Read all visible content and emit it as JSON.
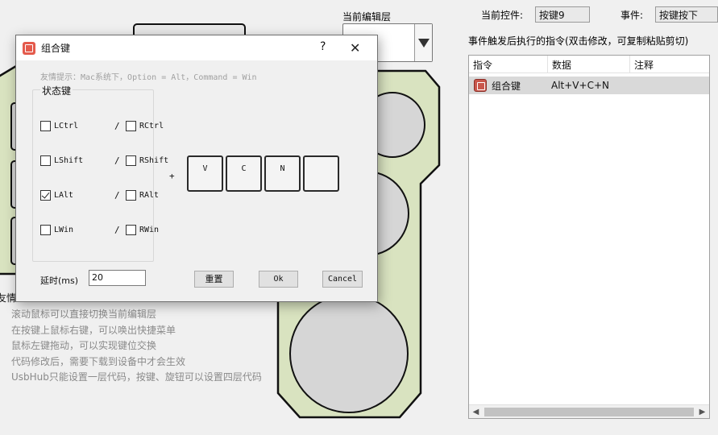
{
  "app": {
    "edit_layer_label": "当前编辑层",
    "current_control_label": "当前控件:",
    "current_control_value": "按键9",
    "event_label": "事件:",
    "event_value": "按键按下",
    "commands_caption": "事件触发后执行的指令(双击修改，可复制粘贴剪切)",
    "table_headers": [
      "指令",
      "数据",
      "注释"
    ],
    "rows": [
      {
        "command": "组合键",
        "data": "Alt+V+C+N",
        "note": ""
      }
    ],
    "hint_title": "友情",
    "hints": [
      "滚动鼠标可以直接切换当前编辑层",
      "在按键上鼠标右键，可以唤出快捷菜单",
      "鼠标左键拖动，可以实现键位交换",
      "代码修改后，需要下载到设备中才会生效",
      "UsbHub只能设置一层代码，按键、旋钮可以设置四层代码"
    ],
    "colors": {
      "pad_fill": "#d9e3c0",
      "knob_fill": "#d6d6d6",
      "outline": "#111111"
    }
  },
  "dialog": {
    "title": "组合键",
    "help": "?",
    "close": "✕",
    "tip": "友情提示：Mac系统下，Option = Alt，Command = Win",
    "group_title": "状态键",
    "modifiers": [
      {
        "left": "LCtrl",
        "left_checked": false,
        "right": "RCtrl",
        "right_checked": false
      },
      {
        "left": "LShift",
        "left_checked": false,
        "right": "RShift",
        "right_checked": false
      },
      {
        "left": "LAlt",
        "left_checked": true,
        "right": "RAlt",
        "right_checked": false
      },
      {
        "left": "LWin",
        "left_checked": false,
        "right": "RWin",
        "right_checked": false
      }
    ],
    "plus": "+",
    "keys": [
      "V",
      "C",
      "N",
      ""
    ],
    "delay_label": "延时(ms)",
    "delay_value": "20",
    "reset": "重置",
    "ok": "Ok",
    "cancel": "Cancel"
  }
}
